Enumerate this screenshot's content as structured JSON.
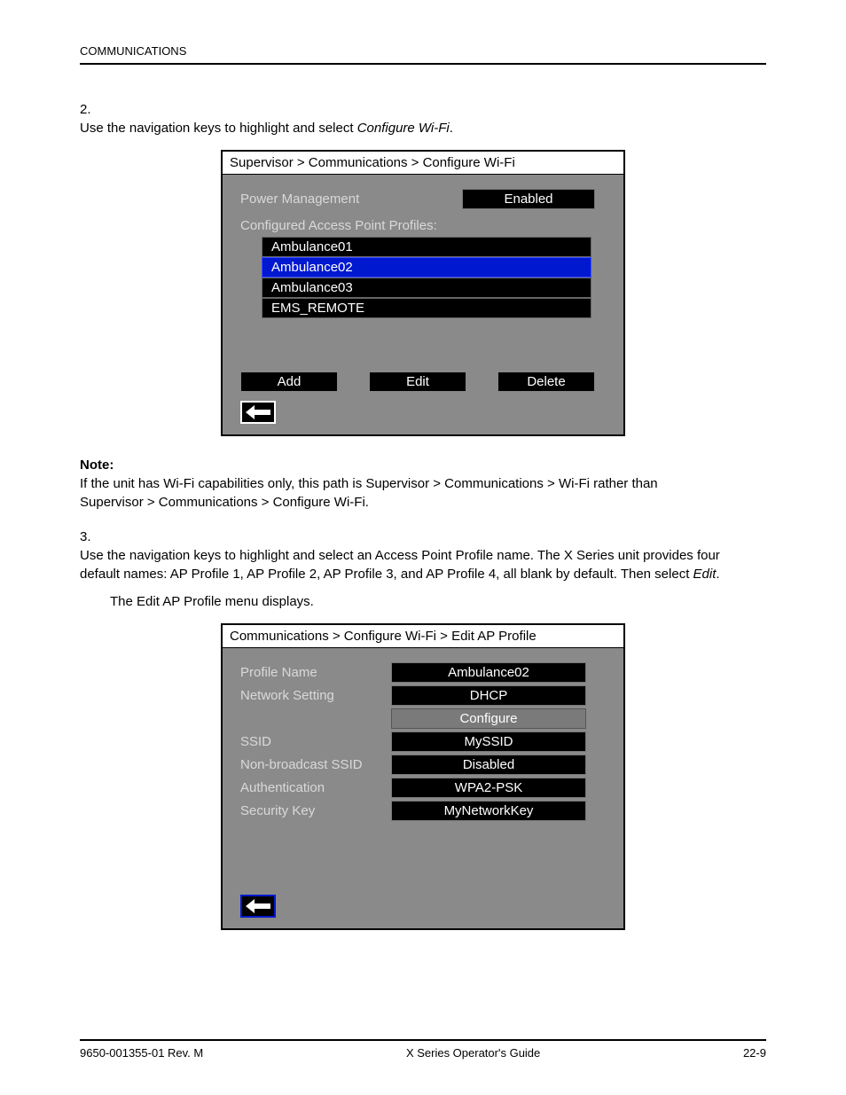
{
  "page_header": {
    "left": "COMMUNICATIONS",
    "right": ""
  },
  "page_footer": {
    "left": "9650-001355-01 Rev. M",
    "right": "X Series Operator's Guide",
    "page": "22-9"
  },
  "step2": {
    "num": "2.",
    "text_before": "Use the navigation keys to highlight and select ",
    "bold": "Configure Wi-Fi",
    "text_after": "."
  },
  "screen1": {
    "breadcrumb": "Supervisor > Communications > Configure Wi-Fi",
    "label_power": "Power Management",
    "value_power": "Enabled",
    "label_profiles": "Configured Access Point Profiles:",
    "profiles": {
      "p0": "Ambulance01",
      "p1": "Ambulance02",
      "p2": "Ambulance03",
      "p3": "EMS_REMOTE"
    },
    "btn_add": "Add",
    "btn_edit": "Edit",
    "btn_delete": "Delete"
  },
  "note": {
    "label": "Note:",
    "text": "If the unit has Wi-Fi capabilities only, this path is Supervisor > Communications > Wi-Fi rather than Supervisor > Communications > Configure Wi-Fi."
  },
  "step3": {
    "num": "3.",
    "text_a": "Use the navigation keys to highlight and select an Access Point Profile name. The X Series unit provides four default names: AP Profile 1, AP Profile 2, AP Profile 3, and AP Profile 4, all blank by default. Then select ",
    "bold": "Edit",
    "text_b": ".",
    "text_after": "The Edit AP Profile menu displays."
  },
  "screen2": {
    "breadcrumb": "Communications > Configure Wi-Fi > Edit AP Profile",
    "rows": {
      "r0": {
        "label": "Profile Name",
        "value": "Ambulance02"
      },
      "r1": {
        "label": "Network Setting",
        "value": "DHCP",
        "configure": "Configure"
      },
      "r2": {
        "label": "SSID",
        "value": "MySSID"
      },
      "r3": {
        "label": "Non-broadcast SSID",
        "value": "Disabled"
      },
      "r4": {
        "label": "Authentication",
        "value": "WPA2-PSK"
      },
      "r5": {
        "label": "Security Key",
        "value": "MyNetworkKey"
      }
    }
  }
}
